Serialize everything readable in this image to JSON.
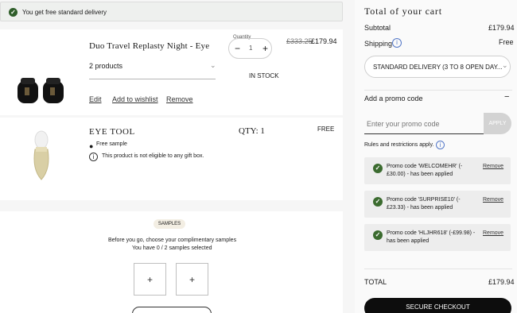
{
  "banner": {
    "text": "You get free standard delivery"
  },
  "item1": {
    "name": "Duo Travel Replasty Night - Eye",
    "quantity_label": "Quantity",
    "quantity": "1",
    "price_old": "£333.25",
    "price_new": "£179.94",
    "variant": "2 products",
    "stock": "IN STOCK",
    "edit": "Edit",
    "wishlist": "Add to wishlist",
    "remove": "Remove"
  },
  "item2": {
    "name": "EYE TOOL",
    "qty": "QTY: 1",
    "price": "FREE",
    "free_sample": "Free sample",
    "gift_note": "This product is not eligible to any gift box."
  },
  "samples": {
    "badge": "SAMPLES",
    "line1": "Before you go, choose your complimentary samples",
    "line2": "You have 0 / 2 samples selected"
  },
  "summary": {
    "title": "Total of your cart",
    "subtotal_label": "Subtotal",
    "subtotal_value": "£179.94",
    "shipping_label": "Shipping",
    "shipping_value": "Free",
    "delivery_option": "STANDARD DELIVERY (3 TO 8 OPEN DAY...",
    "promo_heading": "Add a promo code",
    "promo_placeholder": "Enter your promo code",
    "apply": "APPLY",
    "rules": "Rules and restrictions apply.",
    "promos": [
      {
        "line1": "Promo code 'WELCOMEHR' (-",
        "line2": "£30.00) - has been applied",
        "remove": "Remove"
      },
      {
        "line1": "Promo code 'SURPRISE10' (-",
        "line2": "£23.33) - has been applied",
        "remove": "Remove"
      },
      {
        "line1": "Promo code 'HLJHR618' (-£99.98) -",
        "line2": "has been applied",
        "remove": "Remove"
      }
    ],
    "total_label": "TOTAL",
    "total_value": "£179.94",
    "checkout": "SECURE CHECKOUT"
  }
}
